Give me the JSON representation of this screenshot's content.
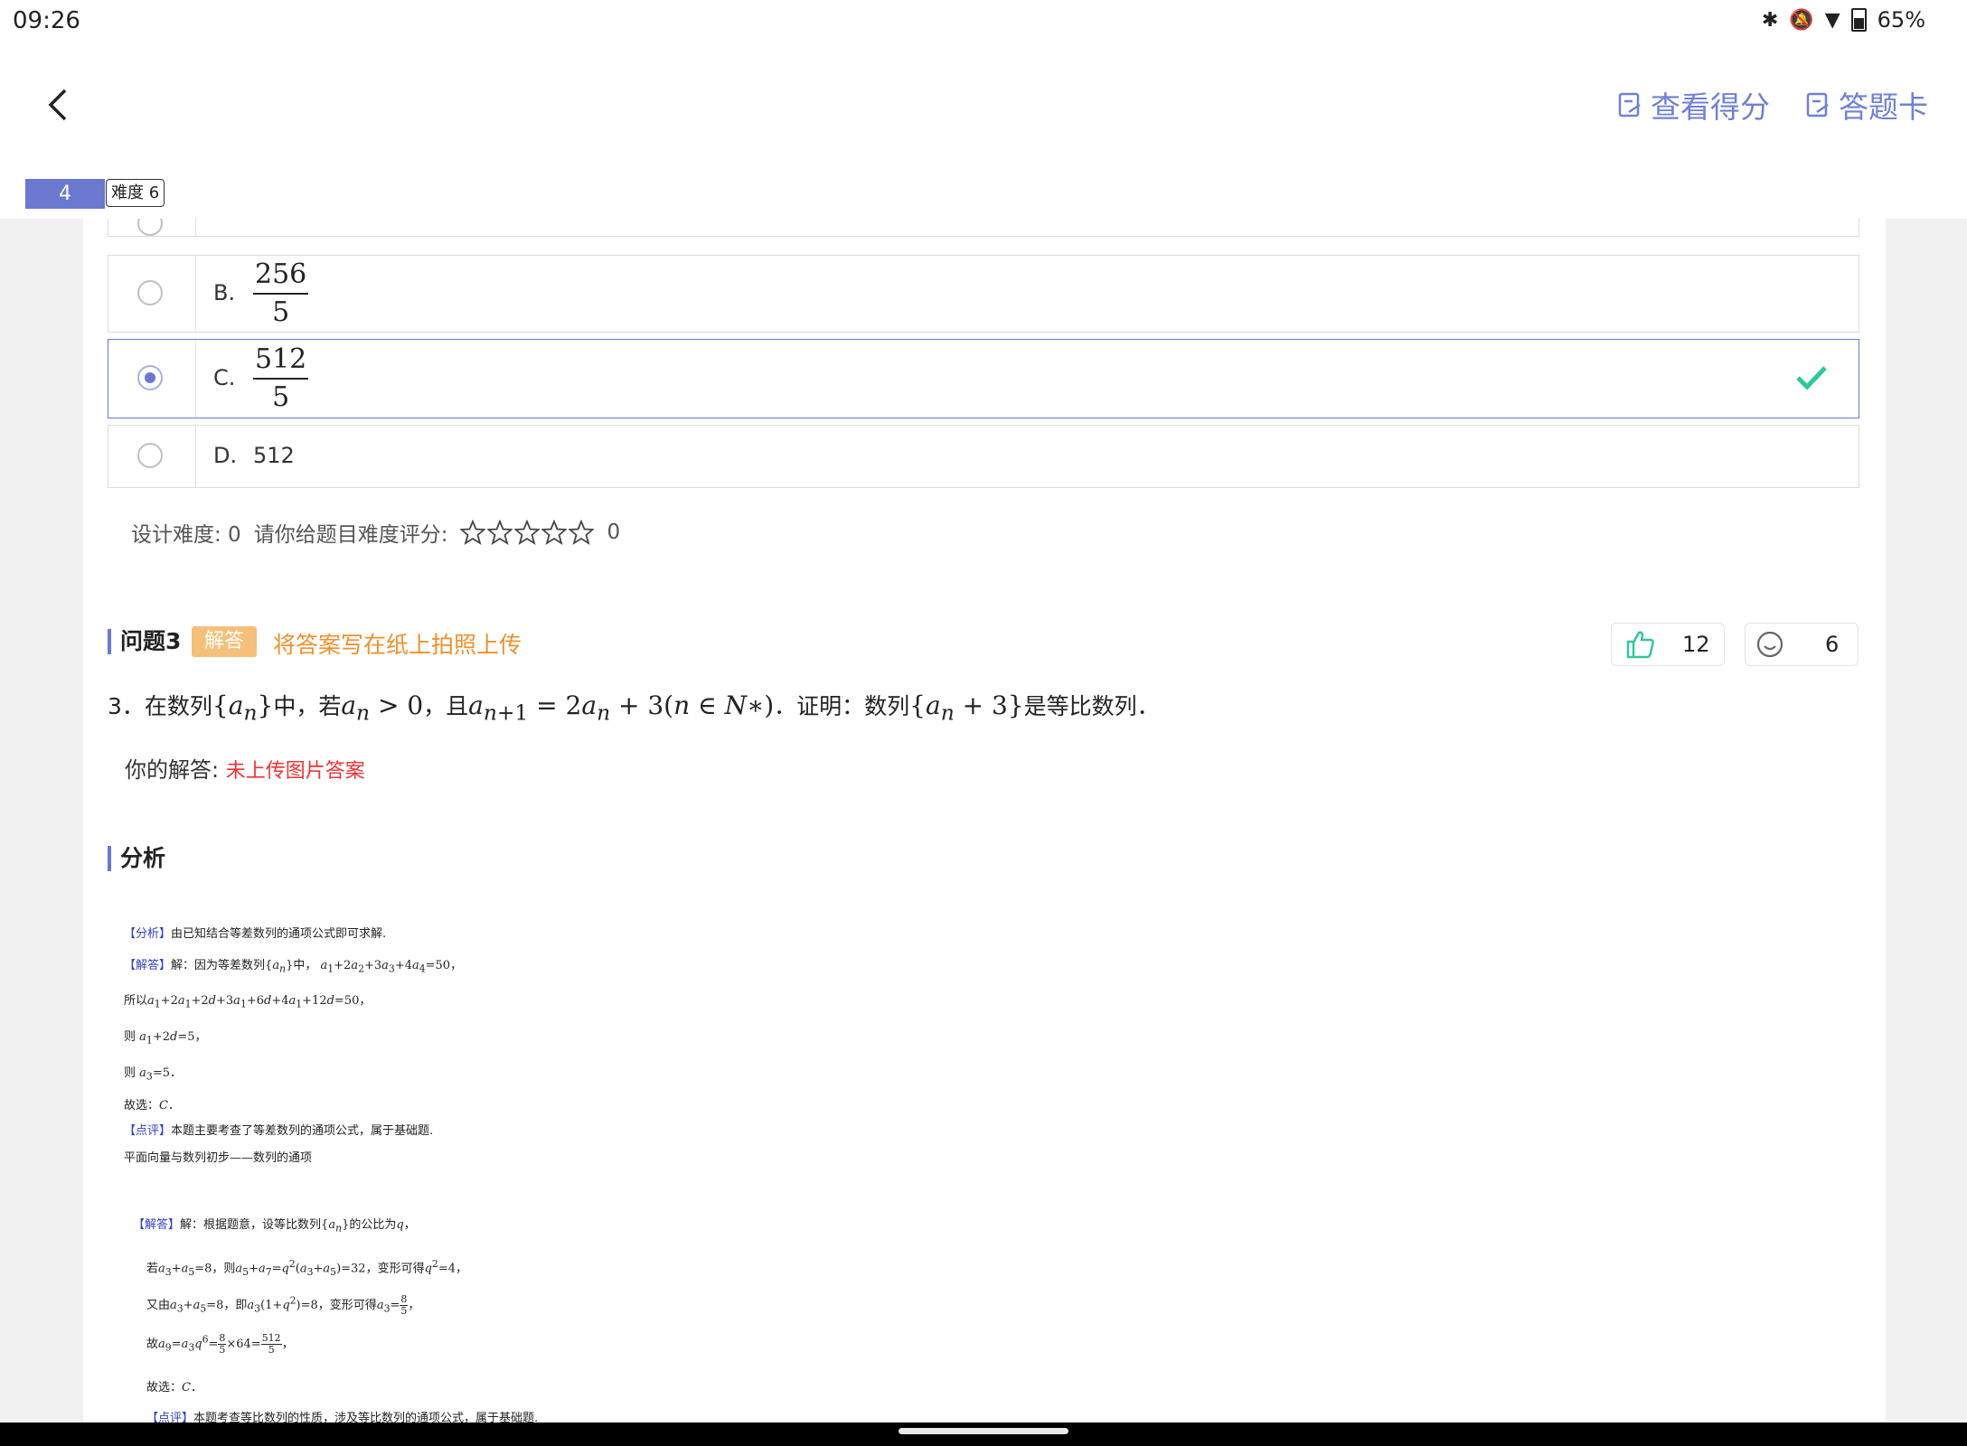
{
  "status_bar": {
    "time": "09:26",
    "battery": "65%"
  },
  "header": {
    "view_score": "查看得分",
    "answer_card": "答题卡",
    "question_number": "4",
    "difficulty": "难度 6"
  },
  "options": [
    {
      "letter": "B.",
      "numerator": "256",
      "denominator": "5"
    },
    {
      "letter": "C.",
      "numerator": "512",
      "denominator": "5",
      "selected": true,
      "correct": true
    },
    {
      "letter": "D.",
      "value": "512"
    }
  ],
  "rating": {
    "design_difficulty": "设计难度:  0",
    "prompt": "请你给题目难度评分:",
    "stars_filled": 0,
    "stars_total": 5,
    "score": "0"
  },
  "question3": {
    "title": "问题3",
    "tag": "解答",
    "hint": "将答案写在纸上拍照上传",
    "likes": "12",
    "faces": "6",
    "number": "3．",
    "text_1": "在数列",
    "text_2": "中，若",
    "text_3": "，且",
    "text_4": "．证明：数列",
    "text_5": "是等比数列．",
    "your_answer_label": "你的解答:",
    "your_answer_value": "未上传图片答案"
  },
  "analysis": {
    "title": "分析",
    "tag_analysis": "【分析】",
    "tag_answer": "【解答】",
    "tag_comment": "【点评】",
    "line_1": "由已知结合等差数列的通项公式即可求解.",
    "line_2_text": "解：因为等差数列",
    "line_2_mid": "中，",
    "line_3_prefix": "所以",
    "line_4_prefix": "则",
    "line_5_prefix": "则",
    "line_6": "故选：",
    "line_7": "本题主要考查了等差数列的通项公式，属于基础题.",
    "line_8": "平面向量与数列初步——数列的通项",
    "line_9_text": "解：根据题意，设等比数列",
    "line_9_end": "的公比为",
    "line_10_a": "若",
    "line_10_b": "，则",
    "line_10_c": "，变形可得",
    "line_11_a": "又由",
    "line_11_b": "，即",
    "line_11_c": "，变形可得",
    "line_12_a": "故",
    "line_13": "故选：",
    "line_14": "本题考查等比数列的性质，涉及等比数列的通项公式，属于基础题."
  },
  "colors": {
    "accent": "#6a78cf",
    "check": "#2ec79b",
    "hint": "#f0902c",
    "error": "#e33333"
  }
}
